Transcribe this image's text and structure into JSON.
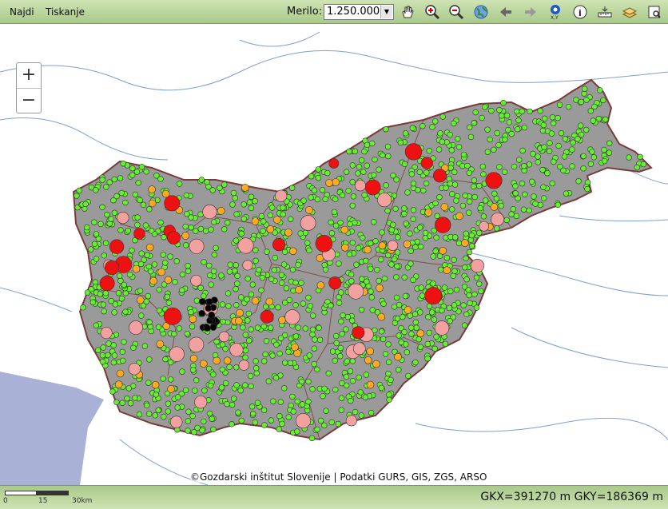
{
  "menu": {
    "find": "Najdi",
    "print": "Tiskanje"
  },
  "toolbar": {
    "scale_label": "Merilo:",
    "scale_value": "1.250.000",
    "tools": [
      "pan-icon",
      "zoom-in-icon",
      "zoom-out-icon",
      "globe-icon",
      "back-arrow-icon",
      "forward-arrow-icon",
      "locate-xy-icon",
      "info-icon",
      "measure-icon",
      "layers-icon",
      "print-preview-icon"
    ]
  },
  "map": {
    "zoom_in": "+",
    "zoom_out": "−",
    "attribution": "©Gozdarski inštitut Slovenije | Podatki GURS, GIS, ZGS, ARSO",
    "colors": {
      "land_outside": "#ffffff",
      "relief": "#9a9a9a",
      "sea": "#a9b2d6",
      "rivers": "#7f9ed0",
      "border": "#7a3b3b",
      "green_point": "#66ee33",
      "orange_point": "#ffaa22",
      "red_point": "#ee1111",
      "pink_point": "#f2a0a0",
      "black_point": "#000000"
    }
  },
  "scalebar": {
    "ticks": [
      "0",
      "15",
      "30km"
    ]
  },
  "coordinates": "GKX=391270 m GKY=186369 m"
}
